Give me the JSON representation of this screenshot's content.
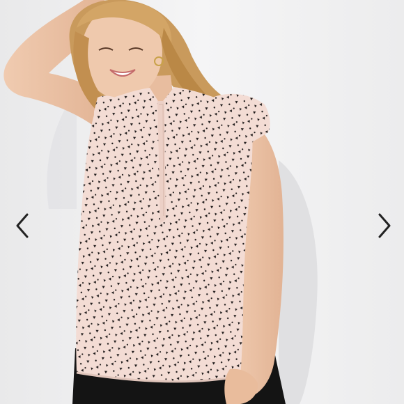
{
  "gallery": {
    "image_subject": "woman-in-polka-dot-sleeveless-blouse",
    "prev_icon": "chevron-left-icon",
    "next_icon": "chevron-right-icon",
    "colors": {
      "background": "#f3f3f4",
      "blouse": "#f3dcd4",
      "dots": "#1e1a1a",
      "pants": "#141414",
      "hair": "#c99a5c",
      "skin": "#ecc4a8",
      "arrow": "#222222"
    }
  }
}
